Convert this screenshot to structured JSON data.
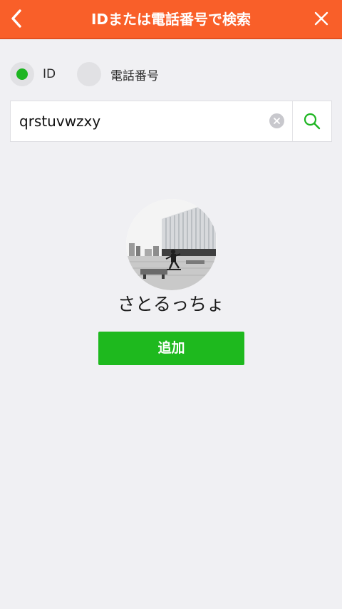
{
  "header": {
    "title": "IDまたは電話番号で検索",
    "background_color": "#f95f29",
    "back_icon": "chevron-left-icon",
    "close_icon": "close-icon"
  },
  "search_type": {
    "options": [
      {
        "label": "ID",
        "selected": true
      },
      {
        "label": "電話番号",
        "selected": false
      }
    ],
    "selected_color": "#1db521"
  },
  "search": {
    "value": "qrstuvwzxy",
    "clear_icon": "clear-icon",
    "search_icon": "search-icon",
    "search_icon_color": "#1db521"
  },
  "result": {
    "name": "さとるっちょ",
    "add_button_label": "追加",
    "add_button_color": "#1eb91e",
    "avatar": "avatar-photo"
  }
}
